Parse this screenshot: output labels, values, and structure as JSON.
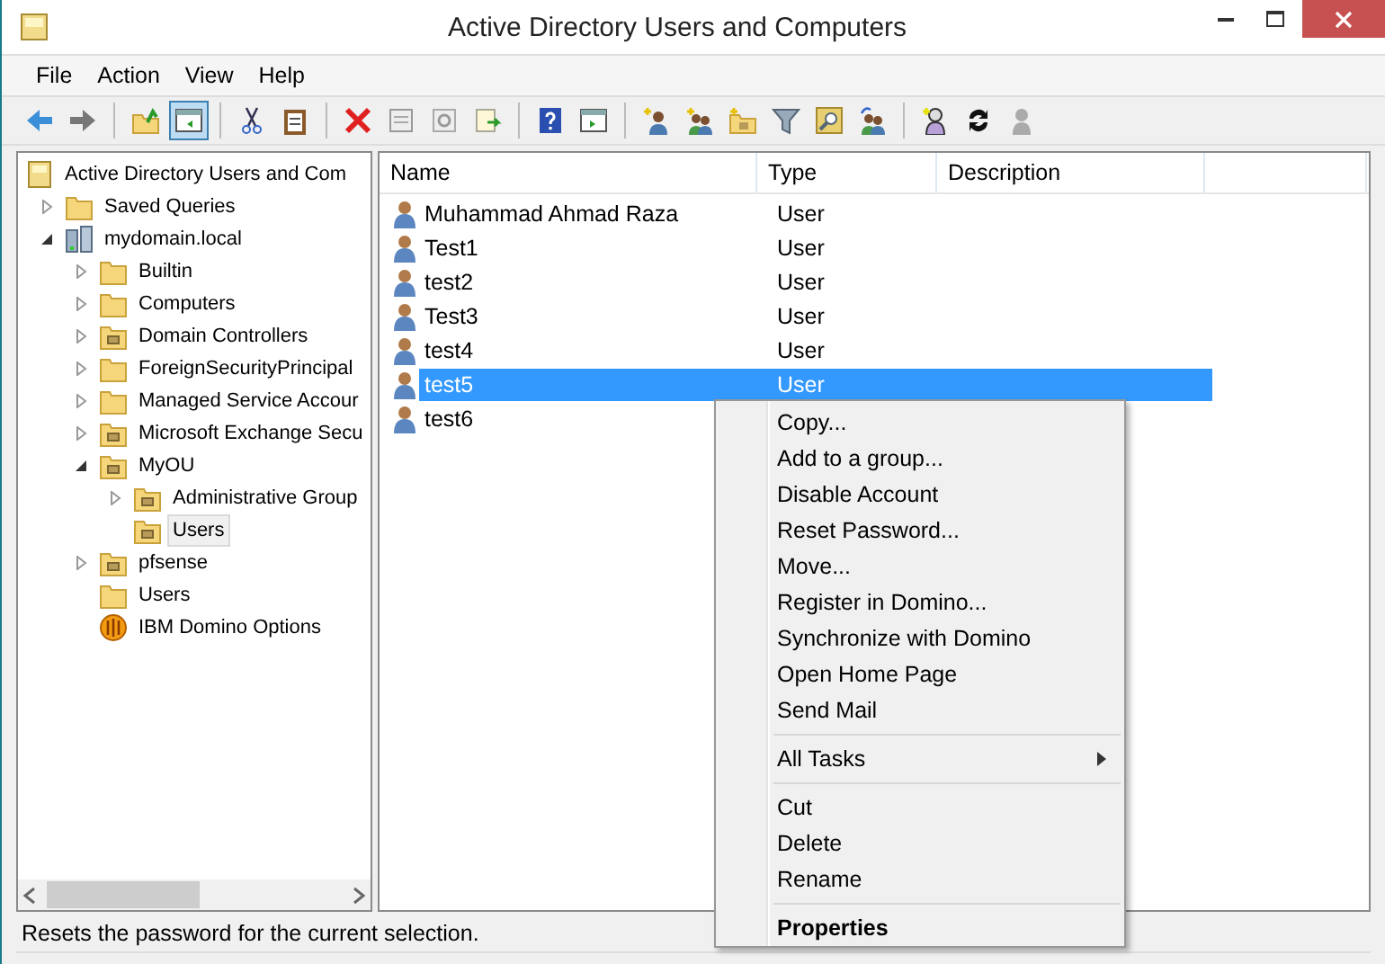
{
  "window": {
    "title": "Active Directory Users and Computers"
  },
  "menu_bar": [
    "File",
    "Action",
    "View",
    "Help"
  ],
  "toolbar": [
    {
      "kind": "back",
      "pressed": false
    },
    {
      "kind": "forward",
      "pressed": false
    },
    {
      "kind": "sep"
    },
    {
      "kind": "up",
      "pressed": false
    },
    {
      "kind": "tree",
      "pressed": true
    },
    {
      "kind": "sep"
    },
    {
      "kind": "cut",
      "pressed": false
    },
    {
      "kind": "paste",
      "pressed": false
    },
    {
      "kind": "sep"
    },
    {
      "kind": "delete",
      "pressed": false
    },
    {
      "kind": "properties",
      "pressed": false
    },
    {
      "kind": "refresh",
      "pressed": false
    },
    {
      "kind": "export",
      "pressed": false
    },
    {
      "kind": "sep"
    },
    {
      "kind": "help",
      "pressed": false
    },
    {
      "kind": "pane",
      "pressed": false
    },
    {
      "kind": "sep"
    },
    {
      "kind": "newuser",
      "pressed": false
    },
    {
      "kind": "newgroup",
      "pressed": false
    },
    {
      "kind": "newou",
      "pressed": false
    },
    {
      "kind": "filter",
      "pressed": false
    },
    {
      "kind": "find",
      "pressed": false
    },
    {
      "kind": "addgroup",
      "pressed": false
    },
    {
      "kind": "sep"
    },
    {
      "kind": "person",
      "pressed": false
    },
    {
      "kind": "sync",
      "pressed": false
    },
    {
      "kind": "grayuser",
      "pressed": false
    }
  ],
  "tree": [
    {
      "label": "Active Directory Users and Com",
      "kind": "root",
      "selected": false,
      "children": [
        {
          "label": "Saved Queries",
          "kind": "folder",
          "expanded": false,
          "selected": false
        },
        {
          "label": "mydomain.local",
          "kind": "domain",
          "expanded": true,
          "selected": false,
          "children": [
            {
              "label": "Builtin",
              "kind": "folder",
              "expanded": false,
              "selected": false
            },
            {
              "label": "Computers",
              "kind": "folder",
              "expanded": false,
              "selected": false
            },
            {
              "label": "Domain Controllers",
              "kind": "ou",
              "expanded": false,
              "selected": false
            },
            {
              "label": "ForeignSecurityPrincipal",
              "kind": "folder",
              "expanded": false,
              "selected": false
            },
            {
              "label": "Managed Service Accour",
              "kind": "folder",
              "expanded": false,
              "selected": false
            },
            {
              "label": "Microsoft Exchange Secu",
              "kind": "ou",
              "expanded": false,
              "selected": false
            },
            {
              "label": "MyOU",
              "kind": "ou",
              "expanded": true,
              "selected": false,
              "children": [
                {
                  "label": "Administrative Group",
                  "kind": "ou",
                  "expanded": false,
                  "selected": false
                },
                {
                  "label": "Users",
                  "kind": "ou",
                  "selected": true
                }
              ]
            },
            {
              "label": "pfsense",
              "kind": "ou",
              "expanded": false,
              "selected": false
            },
            {
              "label": "Users",
              "kind": "folder",
              "selected": false
            },
            {
              "label": "IBM Domino Options",
              "kind": "domino",
              "selected": false
            }
          ]
        }
      ]
    }
  ],
  "table": {
    "columns": [
      "Name",
      "Type",
      "Description"
    ],
    "rows": [
      {
        "name": "Muhammad Ahmad Raza",
        "type": "User",
        "selected": false
      },
      {
        "name": "Test1",
        "type": "User",
        "selected": false
      },
      {
        "name": "test2",
        "type": "User",
        "selected": false
      },
      {
        "name": "Test3",
        "type": "User",
        "selected": false
      },
      {
        "name": "test4",
        "type": "User",
        "selected": false
      },
      {
        "name": "test5",
        "type": "User",
        "selected": true
      },
      {
        "name": "test6",
        "selected": false
      }
    ]
  },
  "context_menu": [
    {
      "kind": "item",
      "label": "Copy...",
      "default": false
    },
    {
      "kind": "item",
      "label": "Add to a group...",
      "default": false
    },
    {
      "kind": "item",
      "label": "Disable Account",
      "default": false
    },
    {
      "kind": "item",
      "label": "Reset Password...",
      "default": false
    },
    {
      "kind": "item",
      "label": "Move...",
      "default": false
    },
    {
      "kind": "item",
      "label": "Register in Domino...",
      "default": false
    },
    {
      "kind": "item",
      "label": "Synchronize with Domino",
      "default": false
    },
    {
      "kind": "item",
      "label": "Open Home Page",
      "default": false
    },
    {
      "kind": "item",
      "label": "Send Mail",
      "default": false
    },
    {
      "kind": "separator"
    },
    {
      "kind": "submenu",
      "label": "All Tasks",
      "default": false
    },
    {
      "kind": "separator"
    },
    {
      "kind": "item",
      "label": "Cut",
      "default": false
    },
    {
      "kind": "item",
      "label": "Delete",
      "default": false
    },
    {
      "kind": "item",
      "label": "Rename",
      "default": false
    },
    {
      "kind": "separator"
    },
    {
      "kind": "item",
      "label": "Properties",
      "default": true
    }
  ],
  "status_bar": "Resets the password for the current selection."
}
